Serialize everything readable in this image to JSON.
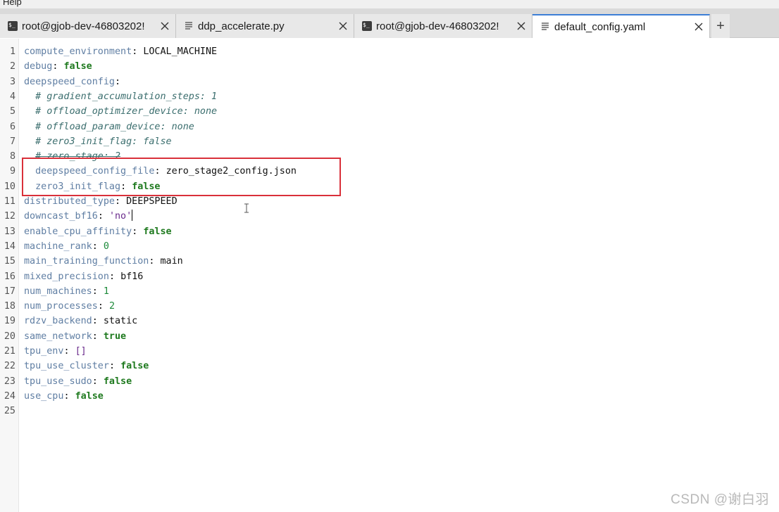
{
  "menubar": {
    "label": "Help"
  },
  "tabs": [
    {
      "label": "root@gjob-dev-46803202!",
      "icon": "terminal-icon",
      "active": false
    },
    {
      "label": "ddp_accelerate.py",
      "icon": "document-lines-icon",
      "active": false
    },
    {
      "label": "root@gjob-dev-46803202!",
      "icon": "terminal-icon",
      "active": false
    },
    {
      "label": "default_config.yaml",
      "icon": "document-lines-icon",
      "active": true
    }
  ],
  "new_tab_label": "+",
  "editor": {
    "lines": [
      {
        "n": "1",
        "indent": "",
        "key": "compute_environment",
        "sep": ": ",
        "value": "LOCAL_MACHINE",
        "vtype": "plain"
      },
      {
        "n": "2",
        "indent": "",
        "key": "debug",
        "sep": ": ",
        "value": "false",
        "vtype": "bool"
      },
      {
        "n": "3",
        "indent": "",
        "key": "deepspeed_config",
        "sep": ":",
        "value": "",
        "vtype": "plain"
      },
      {
        "n": "4",
        "indent": "  ",
        "comment": "# gradient_accumulation_steps: 1"
      },
      {
        "n": "5",
        "indent": "  ",
        "comment": "# offload_optimizer_device: none"
      },
      {
        "n": "6",
        "indent": "  ",
        "comment": "# offload_param_device: none"
      },
      {
        "n": "7",
        "indent": "  ",
        "comment": "# zero3_init_flag: false"
      },
      {
        "n": "8",
        "indent": "  ",
        "comment": "# zero_stage: 2",
        "strike": true
      },
      {
        "n": "9",
        "indent": "  ",
        "key": "deepspeed_config_file",
        "sep": ": ",
        "value": "zero_stage2_config.json",
        "vtype": "plain"
      },
      {
        "n": "10",
        "indent": "  ",
        "key": "zero3_init_flag",
        "sep": ": ",
        "value": "false",
        "vtype": "bool"
      },
      {
        "n": "11",
        "indent": "",
        "key": "distributed_type",
        "sep": ": ",
        "value": "DEEPSPEED",
        "vtype": "plain"
      },
      {
        "n": "12",
        "indent": "",
        "key": "downcast_bf16",
        "sep": ": ",
        "value": "'no'",
        "vtype": "str",
        "caret": true
      },
      {
        "n": "13",
        "indent": "",
        "key": "enable_cpu_affinity",
        "sep": ": ",
        "value": "false",
        "vtype": "bool"
      },
      {
        "n": "14",
        "indent": "",
        "key": "machine_rank",
        "sep": ": ",
        "value": "0",
        "vtype": "num"
      },
      {
        "n": "15",
        "indent": "",
        "key": "main_training_function",
        "sep": ": ",
        "value": "main",
        "vtype": "plain"
      },
      {
        "n": "16",
        "indent": "",
        "key": "mixed_precision",
        "sep": ": ",
        "value": "bf16",
        "vtype": "plain"
      },
      {
        "n": "17",
        "indent": "",
        "key": "num_machines",
        "sep": ": ",
        "value": "1",
        "vtype": "num"
      },
      {
        "n": "18",
        "indent": "",
        "key": "num_processes",
        "sep": ": ",
        "value": "2",
        "vtype": "num"
      },
      {
        "n": "19",
        "indent": "",
        "key": "rdzv_backend",
        "sep": ": ",
        "value": "static",
        "vtype": "plain"
      },
      {
        "n": "20",
        "indent": "",
        "key": "same_network",
        "sep": ": ",
        "value": "true",
        "vtype": "bool"
      },
      {
        "n": "21",
        "indent": "",
        "key": "tpu_env",
        "sep": ": ",
        "value": "[]",
        "vtype": "bracket"
      },
      {
        "n": "22",
        "indent": "",
        "key": "tpu_use_cluster",
        "sep": ": ",
        "value": "false",
        "vtype": "bool"
      },
      {
        "n": "23",
        "indent": "",
        "key": "tpu_use_sudo",
        "sep": ": ",
        "value": "false",
        "vtype": "bool"
      },
      {
        "n": "24",
        "indent": "",
        "key": "use_cpu",
        "sep": ": ",
        "value": "false",
        "vtype": "bool"
      },
      {
        "n": "25",
        "indent": "",
        "key": "",
        "sep": "",
        "value": "",
        "vtype": "plain"
      }
    ]
  },
  "annotation": {
    "color": "#d9303a",
    "highlighted_lines": [
      "9",
      "10"
    ]
  },
  "watermark": "CSDN @谢白羽"
}
